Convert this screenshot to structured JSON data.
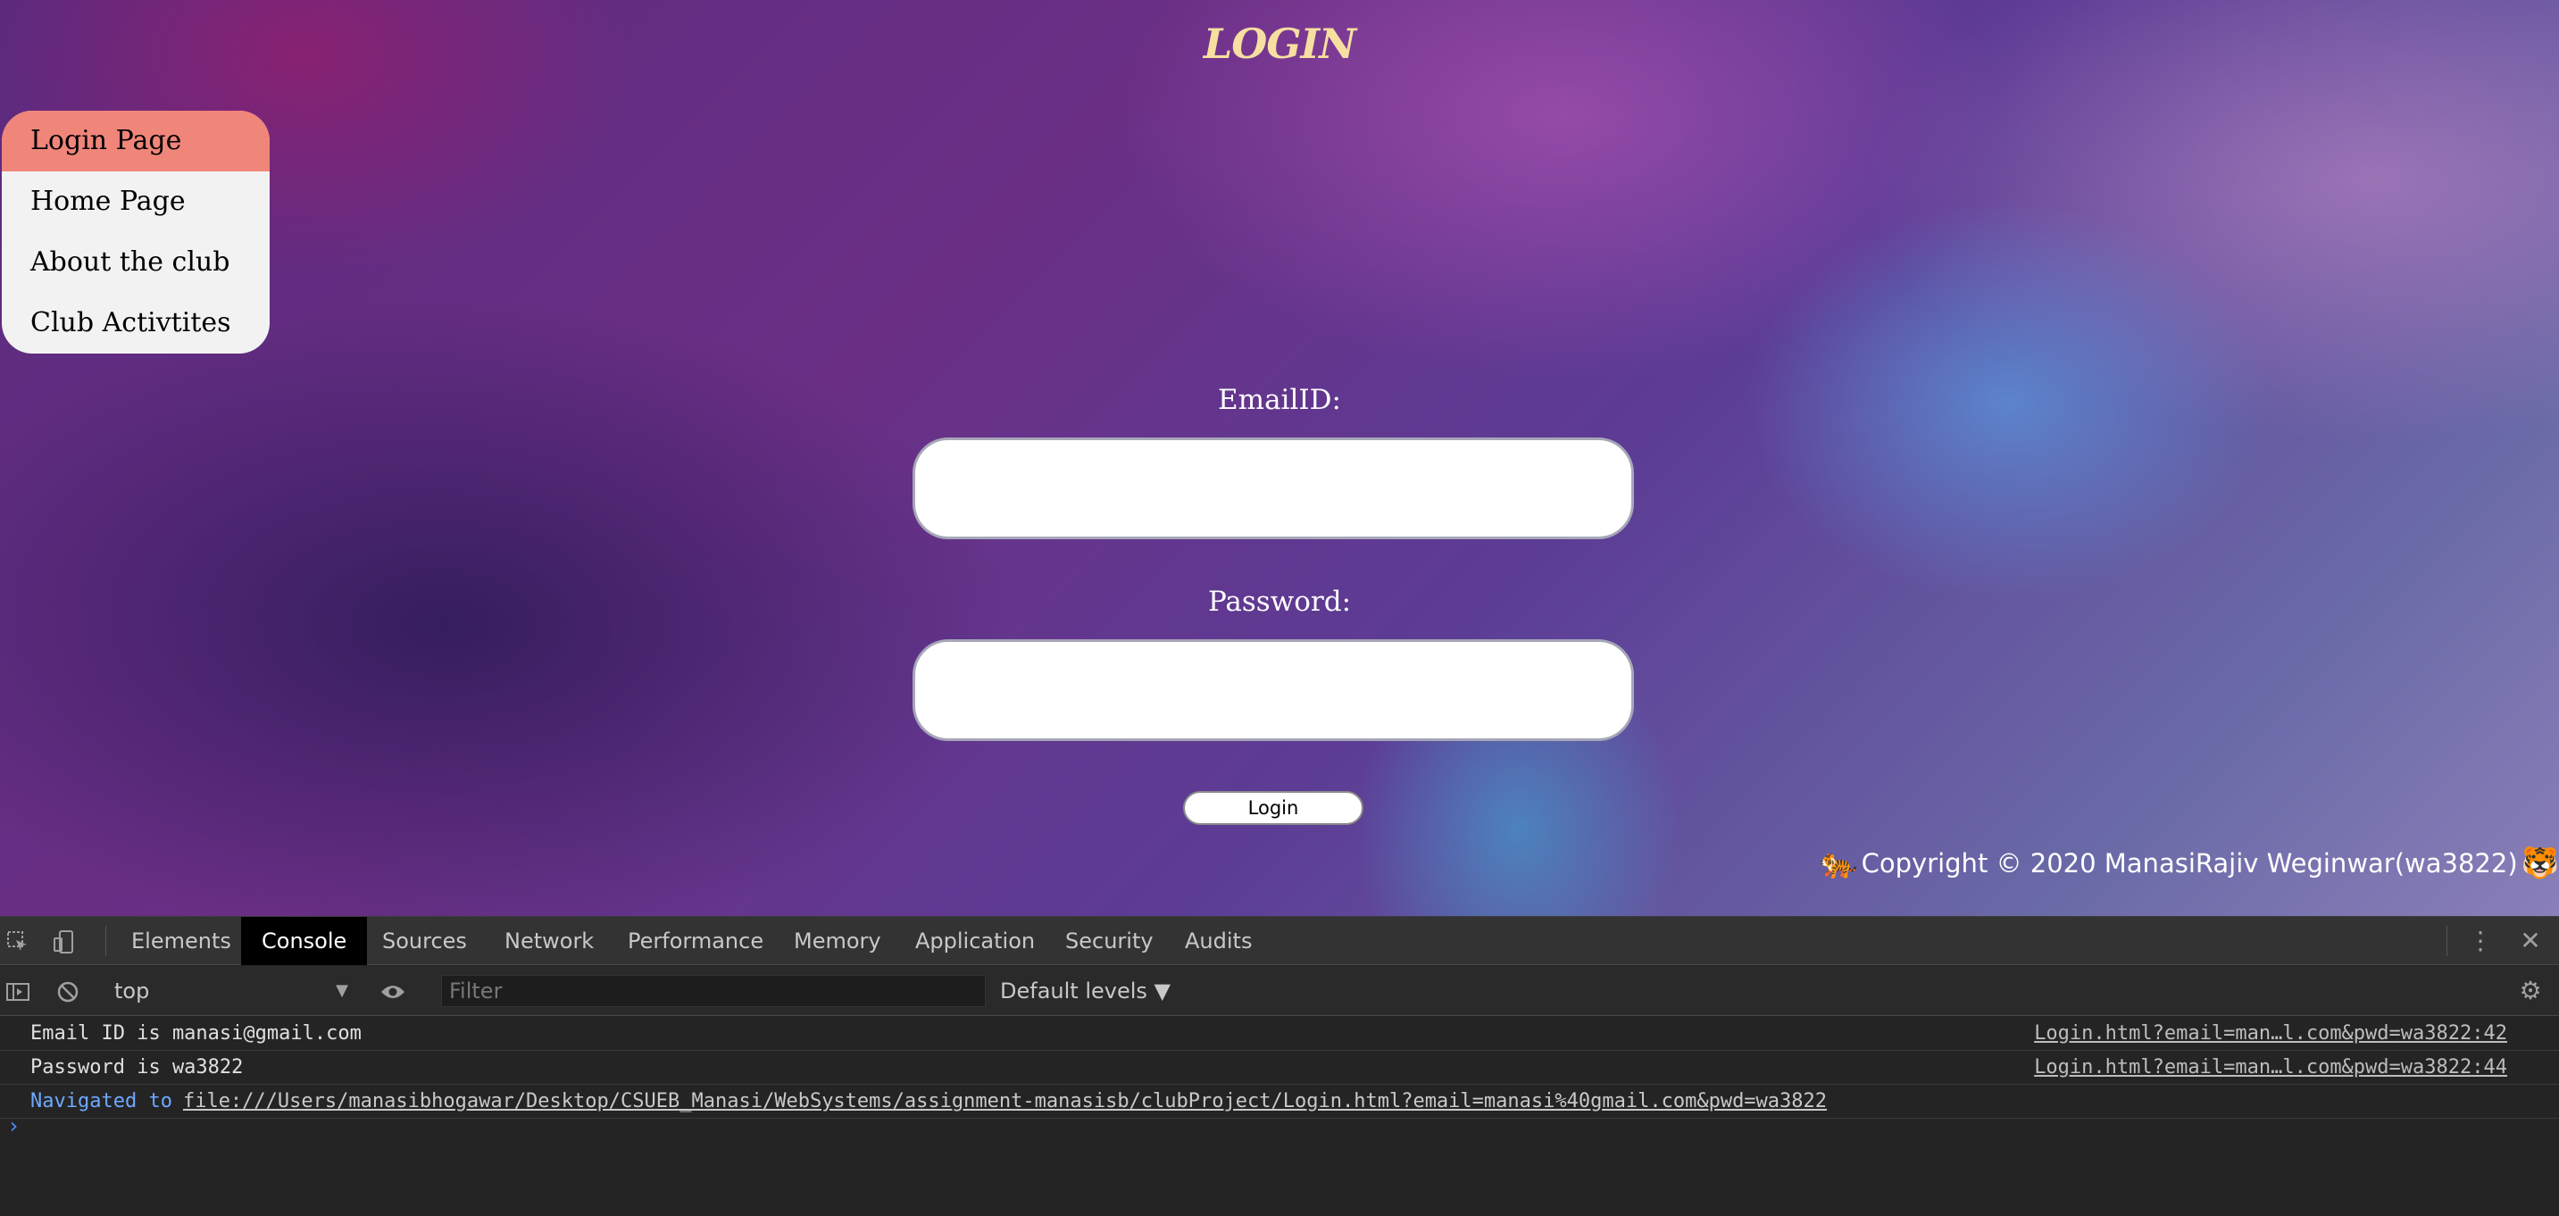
{
  "page": {
    "title": "LOGIN",
    "nav": [
      {
        "label": "Login Page",
        "active": true
      },
      {
        "label": "Home Page",
        "active": false
      },
      {
        "label": "About the club",
        "active": false
      },
      {
        "label": "Club Activtites",
        "active": false
      }
    ],
    "form": {
      "email_label": "EmailID:",
      "email_value": "",
      "password_label": "Password:",
      "password_value": "",
      "login_button": "Login"
    },
    "copyright": {
      "text": "Copyright © 2020 ManasiRajiv Weginwar(wa3822)",
      "left_emoji": "🐅",
      "right_emoji": "🐯"
    }
  },
  "devtools": {
    "tabs": [
      "Elements",
      "Console",
      "Sources",
      "Network",
      "Performance",
      "Memory",
      "Application",
      "Security",
      "Audits"
    ],
    "active_tab": "Console",
    "context": "top",
    "filter_placeholder": "Filter",
    "levels": "Default levels ▼",
    "console": [
      {
        "message": "Email ID is manasi@gmail.com",
        "source": "Login.html?email=man…l.com&pwd=wa3822:42"
      },
      {
        "message": "Password is wa3822",
        "source": "Login.html?email=man…l.com&pwd=wa3822:44"
      }
    ],
    "navigation": {
      "prefix": "Navigated to",
      "url": "file:///Users/manasibhogawar/Desktop/CSUEB_Manasi/WebSystems/assignment-manasisb/clubProject/Login.html?email=manasi%40gmail.com&pwd=wa3822"
    },
    "prompt": "›"
  }
}
